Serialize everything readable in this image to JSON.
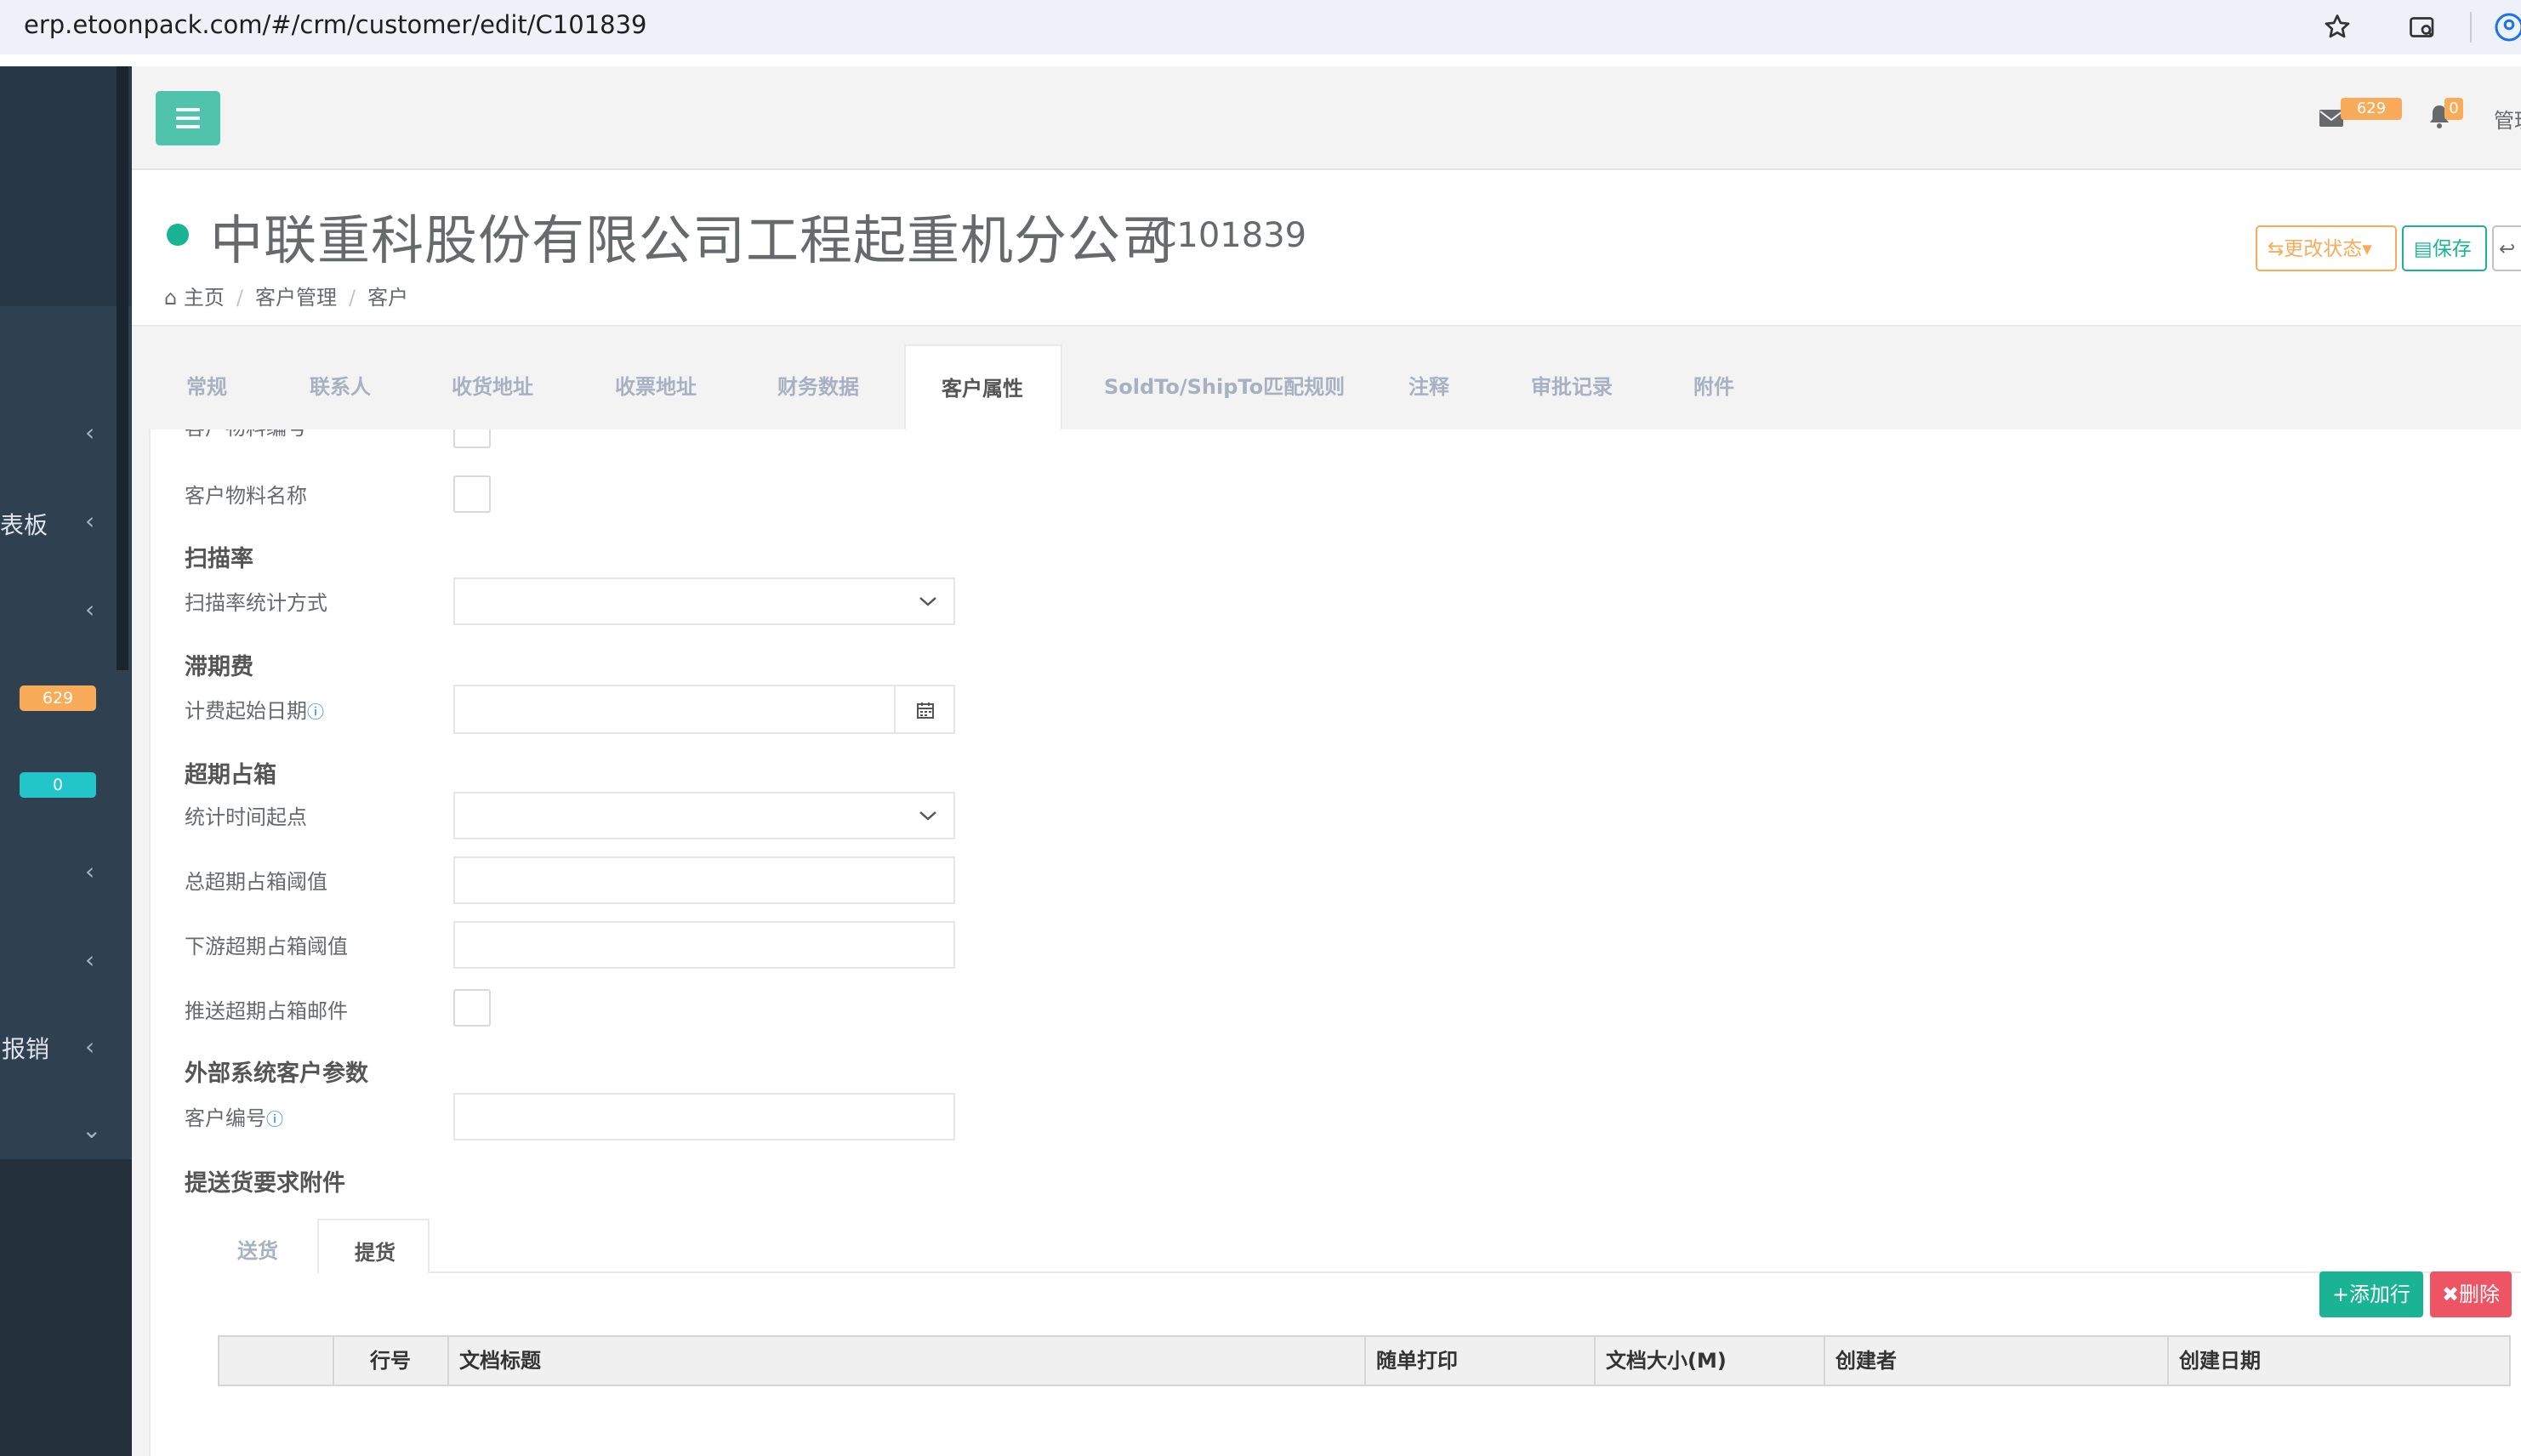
{
  "browser": {
    "url": "erp.etoonpack.com/#/crm/customer/edit/C101839"
  },
  "sidebar": {
    "items": [
      {
        "label": "",
        "chevron": "‹"
      },
      {
        "label": "表板",
        "chevron": "‹"
      },
      {
        "label": "",
        "chevron": "‹"
      },
      {
        "label": "",
        "chevron": "‹"
      },
      {
        "label": "",
        "chevron": "‹"
      },
      {
        "label": "报销",
        "chevron": "‹"
      },
      {
        "label": "",
        "chevron": "⌄"
      }
    ],
    "badge_mail": "629",
    "badge_notify": "0"
  },
  "navbar": {
    "mail_count": "629",
    "bell_count": "0",
    "user_label": "管理"
  },
  "header": {
    "title": "中联重科股份有限公司工程起重机分公司",
    "code": "/C101839",
    "breadcrumb": [
      "主页",
      "客户管理",
      "客户"
    ],
    "change_status_label": "更改状态",
    "save_label": "保存"
  },
  "tabs": [
    "常规",
    "联系人",
    "收货地址",
    "收票地址",
    "财务数据",
    "客户属性",
    "SoldTo/ShipTo匹配规则",
    "注释",
    "审批记录",
    "附件"
  ],
  "active_tab": "客户属性",
  "form": {
    "field_material_code": "客户物料编号",
    "field_material_name": "客户物料名称",
    "section_scan": "扫描率",
    "field_scan_method": "扫描率统计方式",
    "section_demurrage": "滞期费",
    "field_fee_start": "计费起始日期",
    "section_overdue": "超期占箱",
    "field_stat_start": "统计时间起点",
    "field_total_threshold": "总超期占箱阈值",
    "field_downstream_threshold": "下游超期占箱阈值",
    "field_push_mail": "推送超期占箱邮件",
    "section_external": "外部系统客户参数",
    "field_customer_no": "客户编号",
    "section_attachments": "提送货要求附件"
  },
  "subtabs": [
    "送货",
    "提货"
  ],
  "active_subtab": "提货",
  "table": {
    "add_row": "添加行",
    "delete": "删除",
    "columns": [
      "",
      "行号",
      "文档标题",
      "随单打印",
      "文档大小(M)",
      "创建者",
      "创建日期"
    ]
  },
  "colors": {
    "accent": "#1ab394",
    "warning": "#f8ac59",
    "danger": "#ed5565",
    "info": "#23c6c8"
  }
}
